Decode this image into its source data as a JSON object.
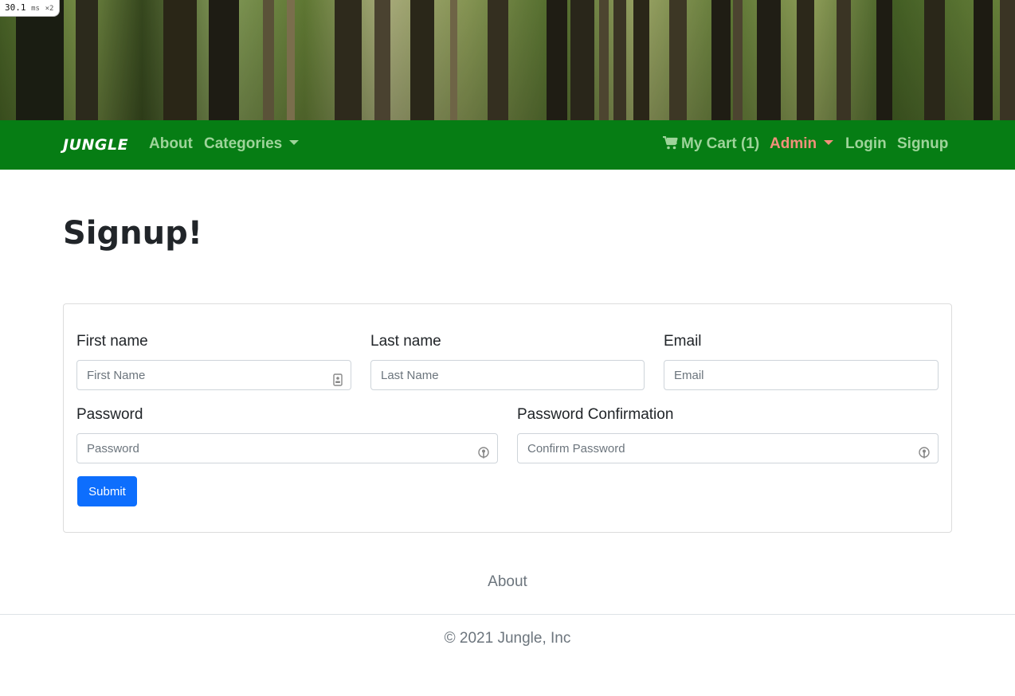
{
  "perf_badge": {
    "value": "30.1",
    "unit": "ms",
    "multiplier": "×2"
  },
  "navbar": {
    "brand": "JUNGLE",
    "about": "About",
    "categories": "Categories",
    "cart": "My Cart (1)",
    "admin": "Admin",
    "login": "Login",
    "signup": "Signup",
    "background_color": "#067d14",
    "link_color": "#9ed49a",
    "admin_color": "#f3907b"
  },
  "page": {
    "title": "Signup!"
  },
  "form": {
    "first_name": {
      "label": "First name",
      "placeholder": "First Name",
      "value": ""
    },
    "last_name": {
      "label": "Last name",
      "placeholder": "Last Name",
      "value": ""
    },
    "email": {
      "label": "Email",
      "placeholder": "Email",
      "value": ""
    },
    "password": {
      "label": "Password",
      "placeholder": "Password",
      "value": ""
    },
    "password_confirmation": {
      "label": "Password Confirmation",
      "placeholder": "Confirm Password",
      "value": ""
    },
    "submit_label": "Submit",
    "submit_color": "#0d6efd"
  },
  "footer": {
    "about": "About",
    "copyright": "© 2021 Jungle, Inc"
  },
  "icons": {
    "cart": "shopping-cart-icon",
    "contact_autofill": "contact-card-icon",
    "password_autofill": "key-icon"
  }
}
